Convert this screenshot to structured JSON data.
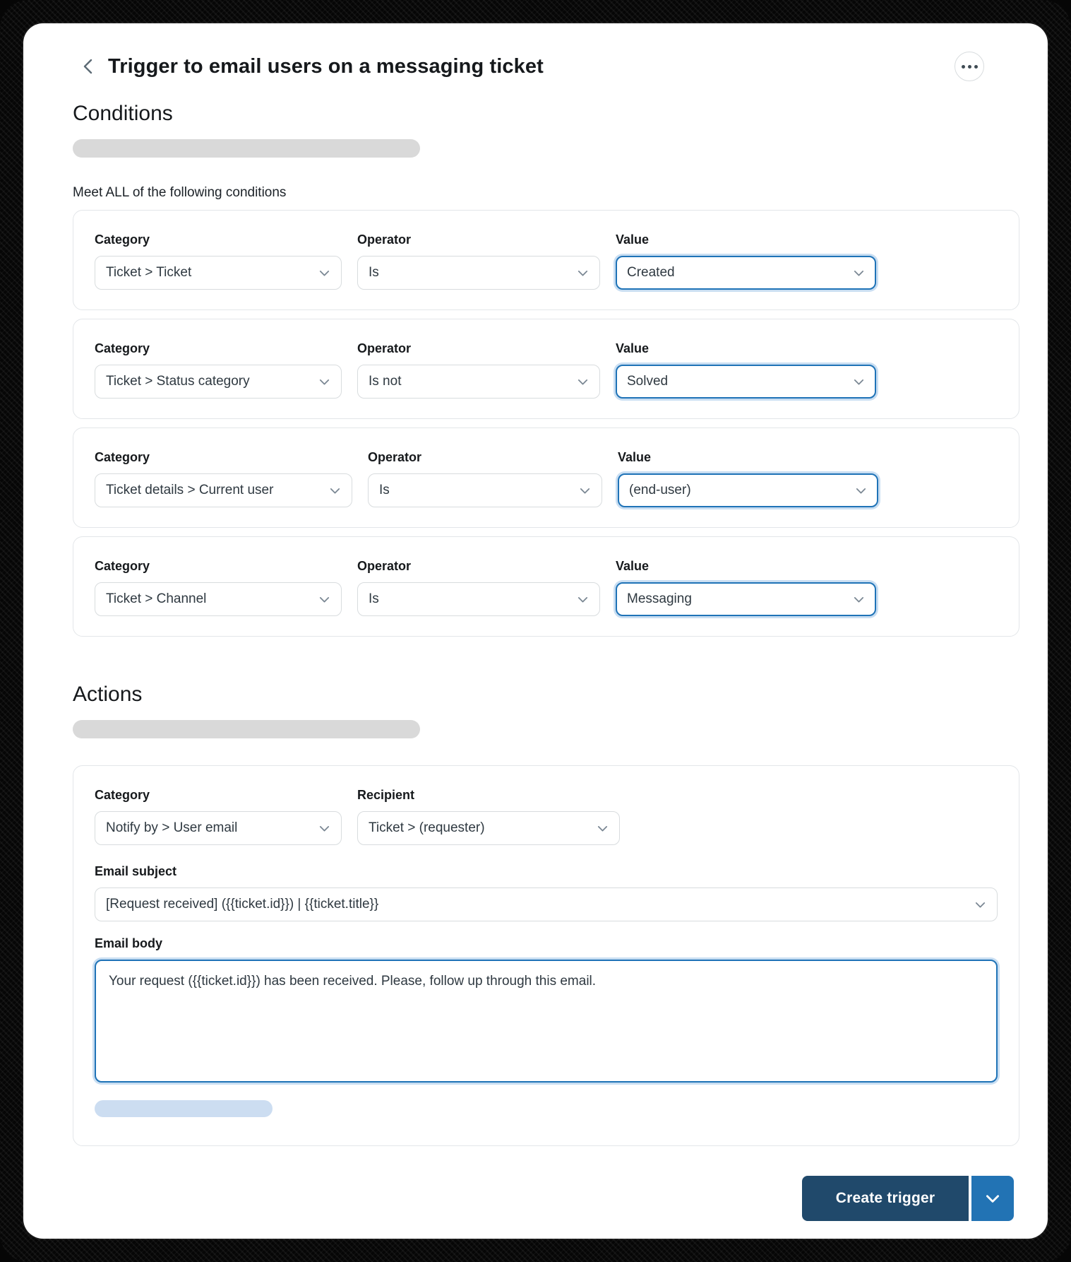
{
  "header": {
    "title": "Trigger to email users on a messaging ticket",
    "back_icon": "chevron-left-icon",
    "menu_icon": "kebab-menu-icon"
  },
  "conditions": {
    "heading": "Conditions",
    "meet_all_label": "Meet ALL of the following conditions",
    "labels": {
      "category": "Category",
      "operator": "Operator",
      "value": "Value"
    },
    "rows": [
      {
        "category": "Ticket > Ticket",
        "operator": "Is",
        "value": "Created"
      },
      {
        "category": "Ticket > Status category",
        "operator": "Is not",
        "value": "Solved"
      },
      {
        "category": "Ticket details > Current user",
        "operator": "Is",
        "value": "(end-user)"
      },
      {
        "category": "Ticket > Channel",
        "operator": "Is",
        "value": "Messaging"
      }
    ]
  },
  "actions": {
    "heading": "Actions",
    "labels": {
      "category": "Category",
      "recipient": "Recipient",
      "email_subject": "Email subject",
      "email_body": "Email body"
    },
    "category_value": "Notify by > User email",
    "recipient_value": "Ticket > (requester)",
    "email_subject_value": "[Request received] ({{ticket.id}}) | {{ticket.title}}",
    "email_body_value": "Your request ({{ticket.id}}) has been received. Please, follow up through this email."
  },
  "footer": {
    "create_button_label": "Create trigger",
    "split_caret_icon": "chevron-down-icon"
  },
  "colors": {
    "focus_accent": "#1f73b7",
    "focus_glow": "#c9def2",
    "primary_button": "#20496b",
    "split_button": "#2273b4",
    "select_border": "#d8dcde",
    "card_border": "#e3e6e9",
    "skeleton_gray": "#d9d9d9",
    "skeleton_blue": "#ccddf1"
  }
}
